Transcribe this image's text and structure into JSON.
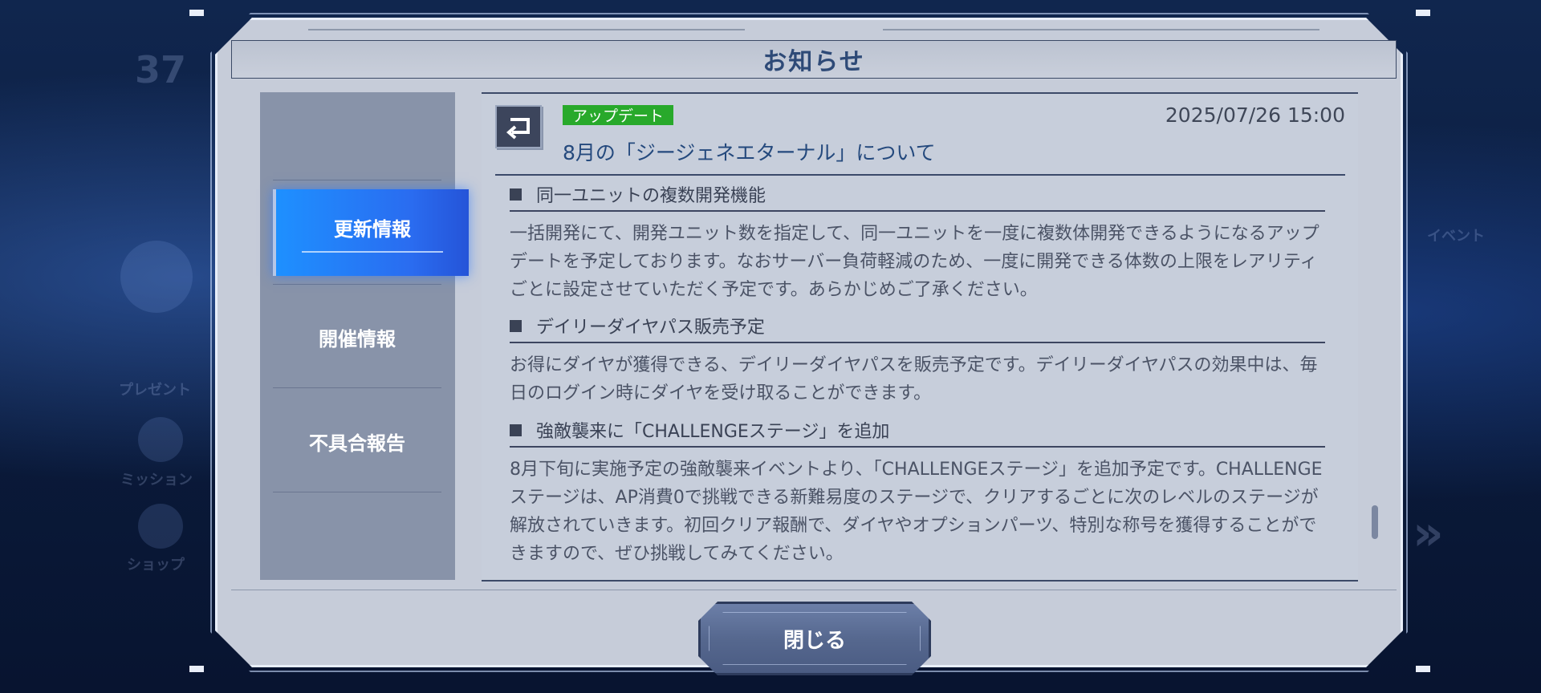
{
  "background": {
    "ghost_texts": [
      "37",
      "プレゼント",
      "ミッション",
      "ショップ",
      "イベント"
    ]
  },
  "modal": {
    "title": "お知らせ",
    "tabs": [
      {
        "label": "更新情報",
        "active": true
      },
      {
        "label": "開催情報",
        "active": false
      },
      {
        "label": "不具合報告",
        "active": false
      }
    ],
    "notice": {
      "tag": "アップデート",
      "tag_color": "#28a92b",
      "date": "2025/07/26 15:00",
      "title": "8月の「ジージェネエターナル」について",
      "sections": [
        {
          "heading": "同一ユニットの複数開発機能",
          "body": "一括開発にて、開発ユニット数を指定して、同一ユニットを一度に複数体開発できるようになるアップデートを予定しております。なおサーバー負荷軽減のため、一度に開発できる体数の上限をレアリティごとに設定させていただく予定です。あらかじめご了承ください。"
        },
        {
          "heading": "デイリーダイヤパス販売予定",
          "body": "お得にダイヤが獲得できる、デイリーダイヤパスを販売予定です。デイリーダイヤパスの効果中は、毎日のログイン時にダイヤを受け取ることができます。"
        },
        {
          "heading": "強敵襲来に「CHALLENGEステージ」を追加",
          "body": "8月下旬に実施予定の強敵襲来イベントより、「CHALLENGEステージ」を追加予定です。CHALLENGEステージは、AP消費0で挑戦できる新難易度のステージで、クリアするごとに次のレベルのステージが解放されていきます。初回クリア報酬で、ダイヤやオプションパーツ、特別な称号を獲得することができますので、ぜひ挑戦してみてください。"
        }
      ]
    },
    "close_label": "閉じる"
  },
  "icons": {
    "back": "return-arrow-icon"
  }
}
